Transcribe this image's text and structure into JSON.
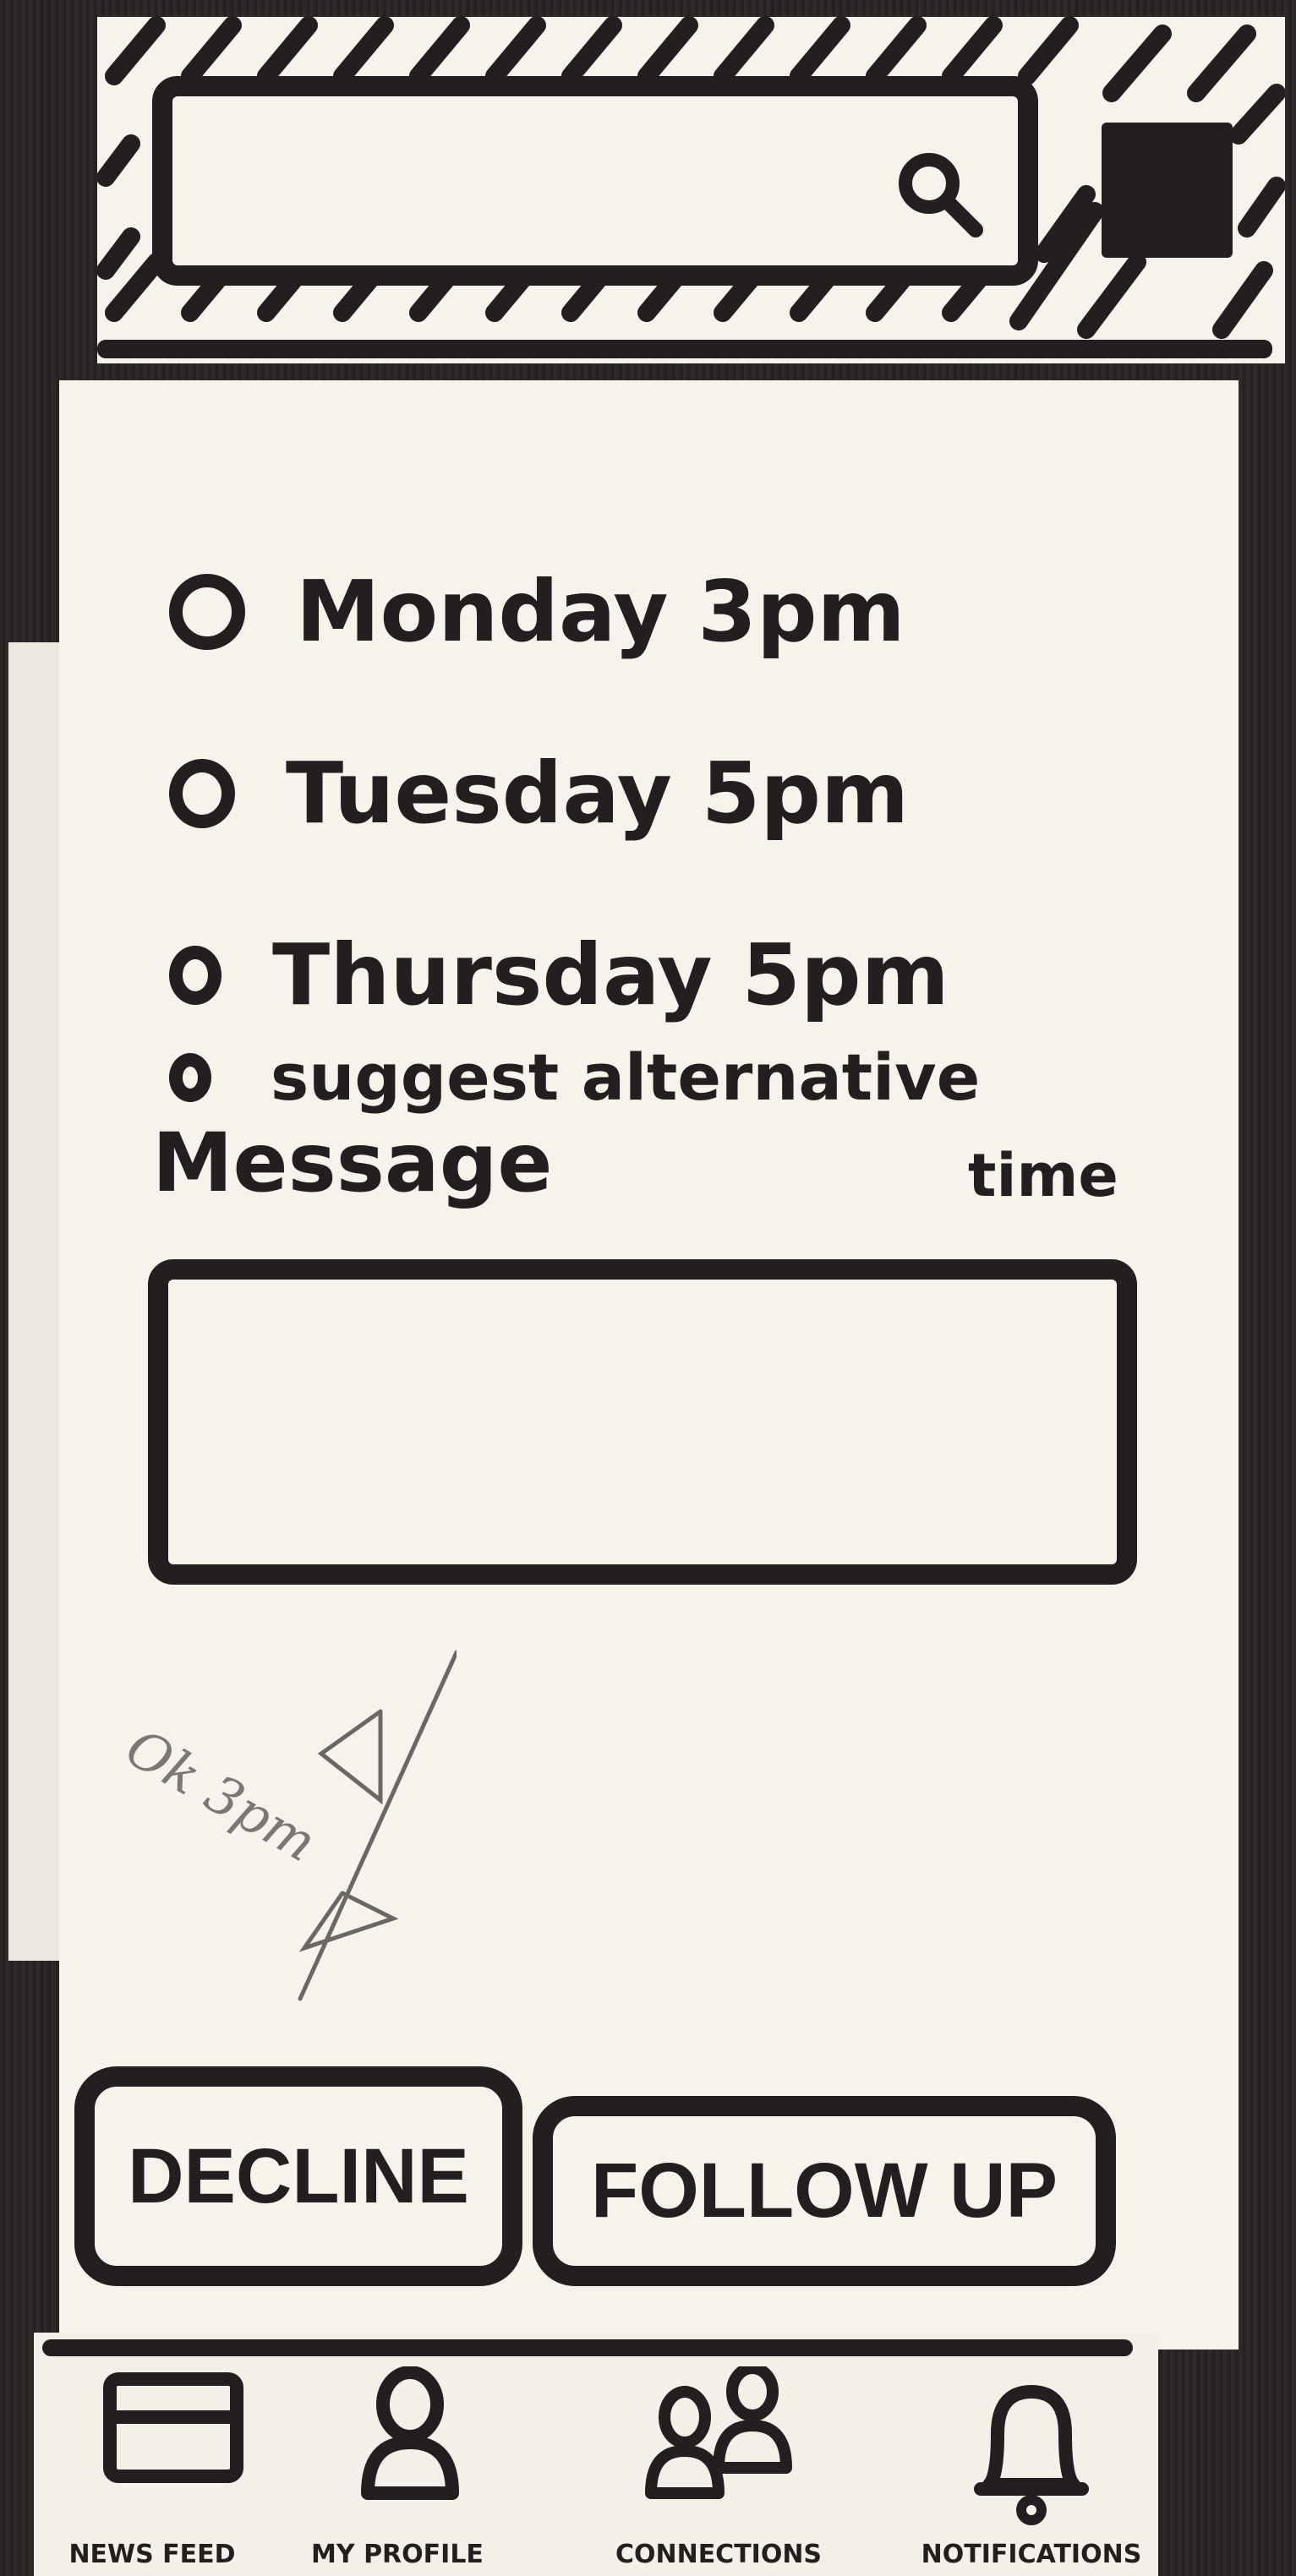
{
  "header": {
    "search_placeholder": ""
  },
  "schedule": {
    "options": [
      {
        "label": "Monday 3pm"
      },
      {
        "label": "Tuesday 5pm"
      },
      {
        "label": "Thursday 5pm"
      },
      {
        "label": "suggest alternative"
      }
    ],
    "option_overflow": "time"
  },
  "message": {
    "label": "Message",
    "value": ""
  },
  "annotation": "Ok 3pm",
  "actions": {
    "decline_label": "DECLINE",
    "follow_up_label": "FOLLOW UP"
  },
  "bottom_nav": {
    "items": [
      {
        "label": "NEWS FEED",
        "icon": "news-feed-icon"
      },
      {
        "label": "MY PROFILE",
        "icon": "profile-icon"
      },
      {
        "label": "CONNECTIONS",
        "icon": "connections-icon"
      },
      {
        "label": "NOTIFICATIONS",
        "icon": "bell-icon"
      }
    ]
  },
  "colors": {
    "ink": "#231f20",
    "paper": "#f6f3ec",
    "background": "#2a2726"
  }
}
